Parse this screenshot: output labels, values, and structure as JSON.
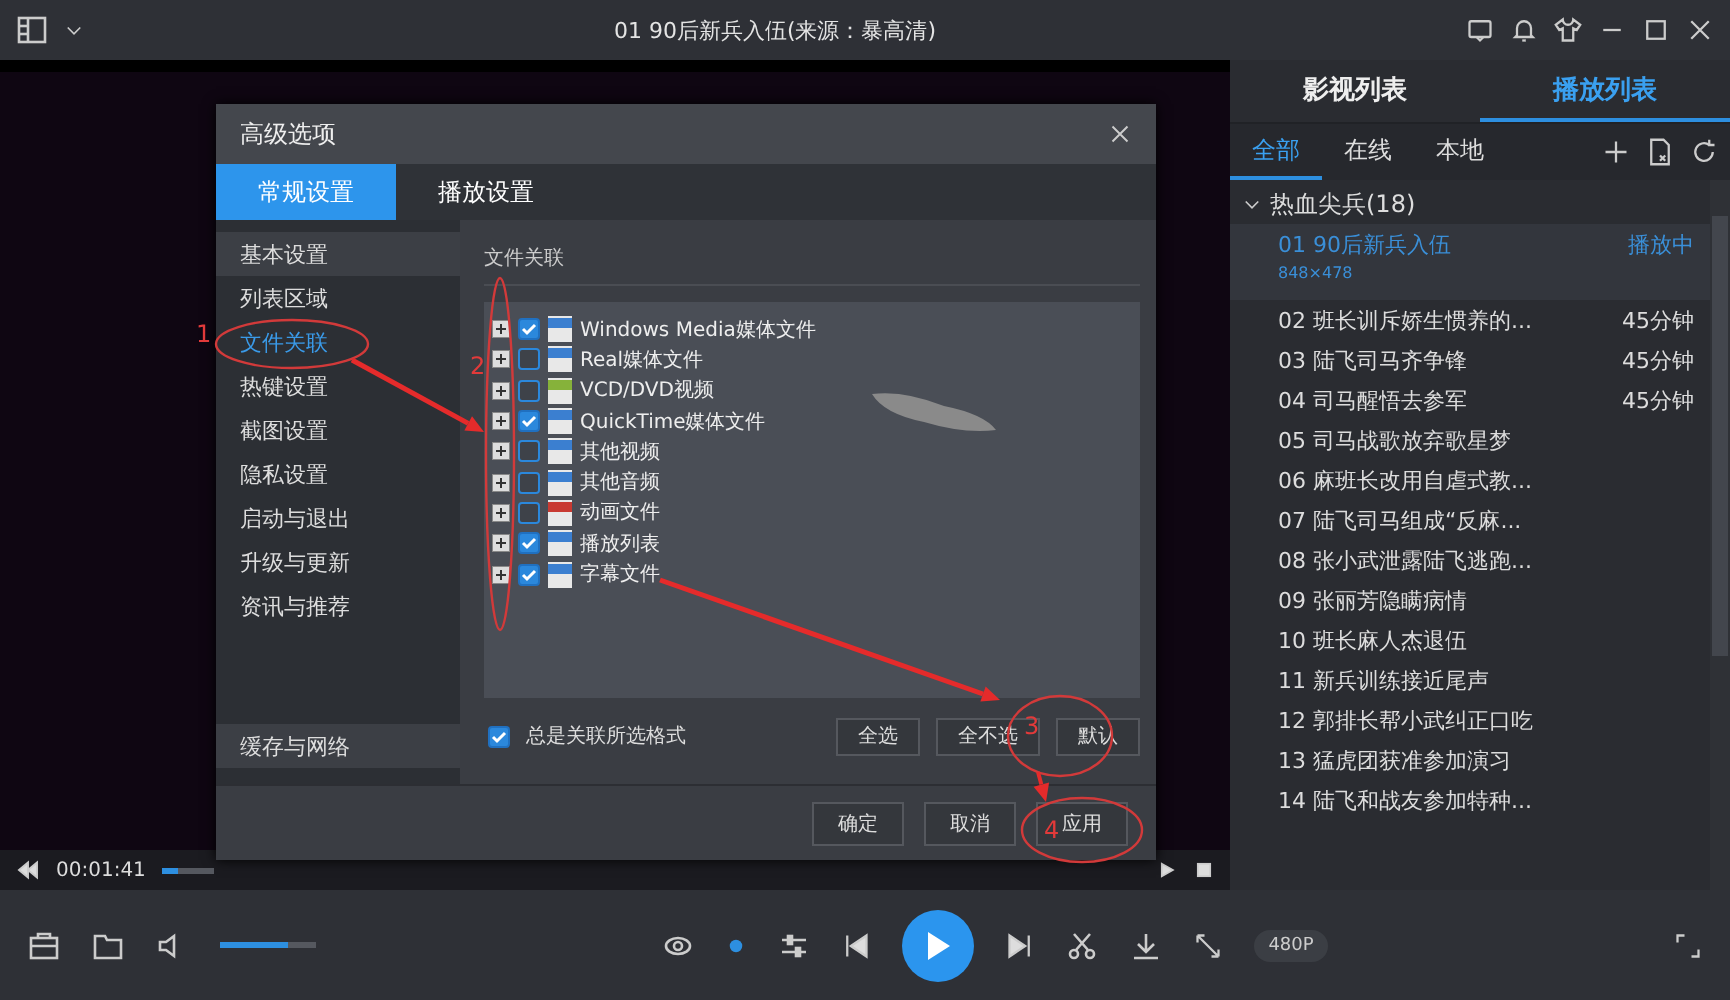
{
  "window": {
    "title": "01 90后新兵入伍(来源：暴高清)"
  },
  "dialog": {
    "title": "高级选项",
    "tabs": [
      {
        "label": "常规设置",
        "selected": true
      },
      {
        "label": "播放设置",
        "selected": false
      }
    ],
    "sidebar": [
      {
        "label": "基本设置",
        "selected": false,
        "hovered": true
      },
      {
        "label": "列表区域",
        "selected": false,
        "hovered": false
      },
      {
        "label": "文件关联",
        "selected": true,
        "hovered": false
      },
      {
        "label": "热键设置",
        "selected": false,
        "hovered": false
      },
      {
        "label": "截图设置",
        "selected": false,
        "hovered": false
      },
      {
        "label": "隐私设置",
        "selected": false,
        "hovered": false
      },
      {
        "label": "启动与退出",
        "selected": false,
        "hovered": false
      },
      {
        "label": "升级与更新",
        "selected": false,
        "hovered": false
      },
      {
        "label": "资讯与推荐",
        "selected": false,
        "hovered": false
      }
    ],
    "sidebar_bottom": {
      "label": "缓存与网络"
    },
    "group_label": "文件关联",
    "file_types": [
      {
        "label": "Windows Media媒体文件",
        "checked": true,
        "color": "#3b7fd0"
      },
      {
        "label": "Real媒体文件",
        "checked": false,
        "color": "#3b7fd0"
      },
      {
        "label": "VCD/DVD视频",
        "checked": false,
        "color": "#86b23a"
      },
      {
        "label": "QuickTime媒体文件",
        "checked": true,
        "color": "#3b7fd0"
      },
      {
        "label": "其他视频",
        "checked": false,
        "color": "#3b7fd0"
      },
      {
        "label": "其他音频",
        "checked": false,
        "color": "#3b7fd0"
      },
      {
        "label": "动画文件",
        "checked": false,
        "color": "#c83a32"
      },
      {
        "label": "播放列表",
        "checked": true,
        "color": "#3b7fd0"
      },
      {
        "label": "字幕文件",
        "checked": true,
        "color": "#3b7fd0"
      }
    ],
    "always_associate": {
      "label": "总是关联所选格式",
      "checked": true
    },
    "select_buttons": [
      "全选",
      "全不选",
      "默认"
    ],
    "footer_buttons": [
      "确定",
      "取消",
      "应用"
    ]
  },
  "annotations": [
    {
      "label": "1"
    },
    {
      "label": "2"
    },
    {
      "label": "3"
    },
    {
      "label": "4"
    }
  ],
  "panel": {
    "tabs": [
      {
        "label": "影视列表",
        "selected": false
      },
      {
        "label": "播放列表",
        "selected": true
      }
    ],
    "subtabs": [
      {
        "label": "全部",
        "selected": true
      },
      {
        "label": "在线",
        "selected": false
      },
      {
        "label": "本地",
        "selected": false
      }
    ],
    "group": {
      "title": "热血尖兵(18)",
      "expanded": true
    },
    "items": [
      {
        "number": "01",
        "title": "90后新兵入伍",
        "status": "播放中",
        "resolution": "848×478",
        "selected": true
      },
      {
        "number": "02",
        "title": "班长训斥娇生惯养的...",
        "duration": "45分钟",
        "selected": false
      },
      {
        "number": "03",
        "title": "陆飞司马齐争锋",
        "duration": "45分钟",
        "selected": false
      },
      {
        "number": "04",
        "title": "司马醒悟去参军",
        "duration": "45分钟",
        "selected": false
      },
      {
        "number": "05",
        "title": "司马战歌放弃歌星梦",
        "selected": false
      },
      {
        "number": "06",
        "title": "麻班长改用自虐式教...",
        "selected": false
      },
      {
        "number": "07",
        "title": "陆飞司马组成“反麻...",
        "selected": false
      },
      {
        "number": "08",
        "title": "张小武泄露陆飞逃跑...",
        "selected": false
      },
      {
        "number": "09",
        "title": "张丽芳隐瞒病情",
        "selected": false
      },
      {
        "number": "10",
        "title": "班长麻人杰退伍",
        "selected": false
      },
      {
        "number": "11",
        "title": "新兵训练接近尾声",
        "selected": false
      },
      {
        "number": "12",
        "title": "郭排长帮小武纠正口吃",
        "selected": false
      },
      {
        "number": "13",
        "title": "猛虎团获准参加演习",
        "selected": false
      },
      {
        "number": "14",
        "title": "陆飞和战友参加特种...",
        "selected": false
      }
    ]
  },
  "player": {
    "time": "00:01:41",
    "progress": {
      "level": 0.3
    },
    "volume": {
      "level": 0.7
    },
    "quality": "480P"
  }
}
